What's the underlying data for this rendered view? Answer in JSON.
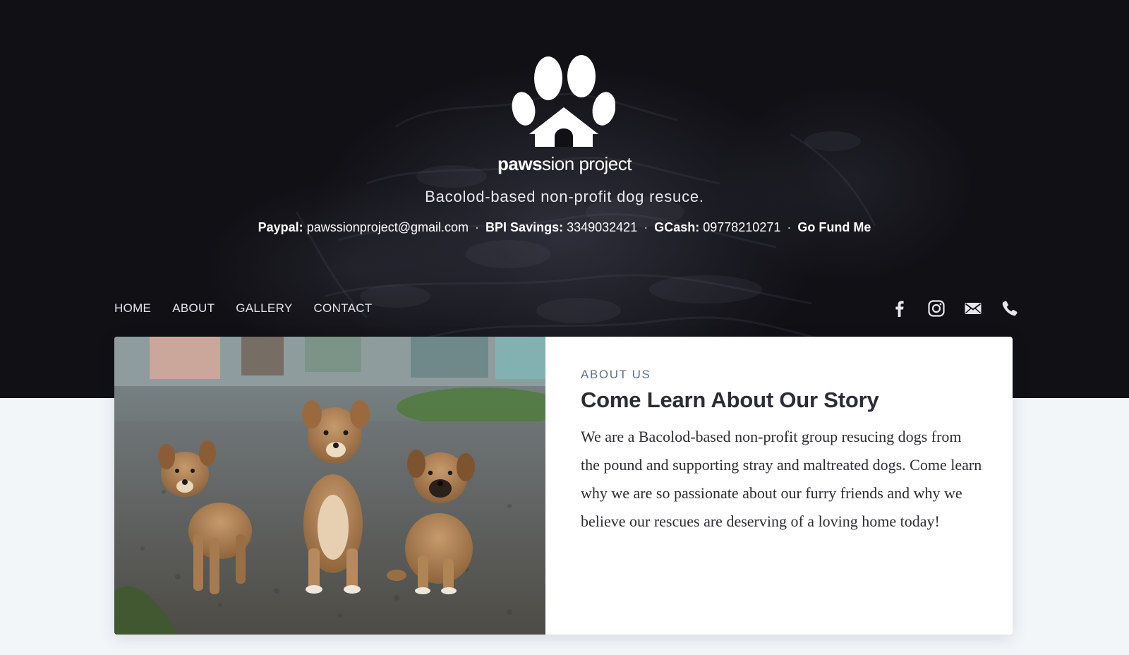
{
  "brand": {
    "name_bold": "paws",
    "name_rest": "sion project",
    "tagline": "Bacolod-based non-profit dog resuce."
  },
  "donations": {
    "paypal_label": "Paypal:",
    "paypal_value": "pawssionproject@gmail.com",
    "bpi_label": "BPI Savings:",
    "bpi_value": "3349032421",
    "gcash_label": "GCash:",
    "gcash_value": "09778210271",
    "gofundme_label": "Go Fund Me",
    "separator": "·"
  },
  "nav": {
    "items": [
      {
        "label": "HOME"
      },
      {
        "label": "ABOUT"
      },
      {
        "label": "GALLERY"
      },
      {
        "label": "CONTACT"
      }
    ]
  },
  "social": {
    "icons": [
      "facebook-icon",
      "instagram-icon",
      "mail-icon",
      "phone-icon"
    ]
  },
  "about": {
    "eyebrow": "ABOUT US",
    "title": "Come Learn About Our Story",
    "body": "We are a Bacolod-based non-profit group resucing dogs from the pound and supporting stray and maltreated dogs. Come learn why we are so passionate about our furry friends and why we believe our rescues are deserving of a loving home today!",
    "photo_alt": "three puppies"
  },
  "colors": {
    "hero_bg": "#101015",
    "page_bg": "#f3f6f9",
    "eyebrow": "#5f7185",
    "title": "#2a2d33"
  }
}
